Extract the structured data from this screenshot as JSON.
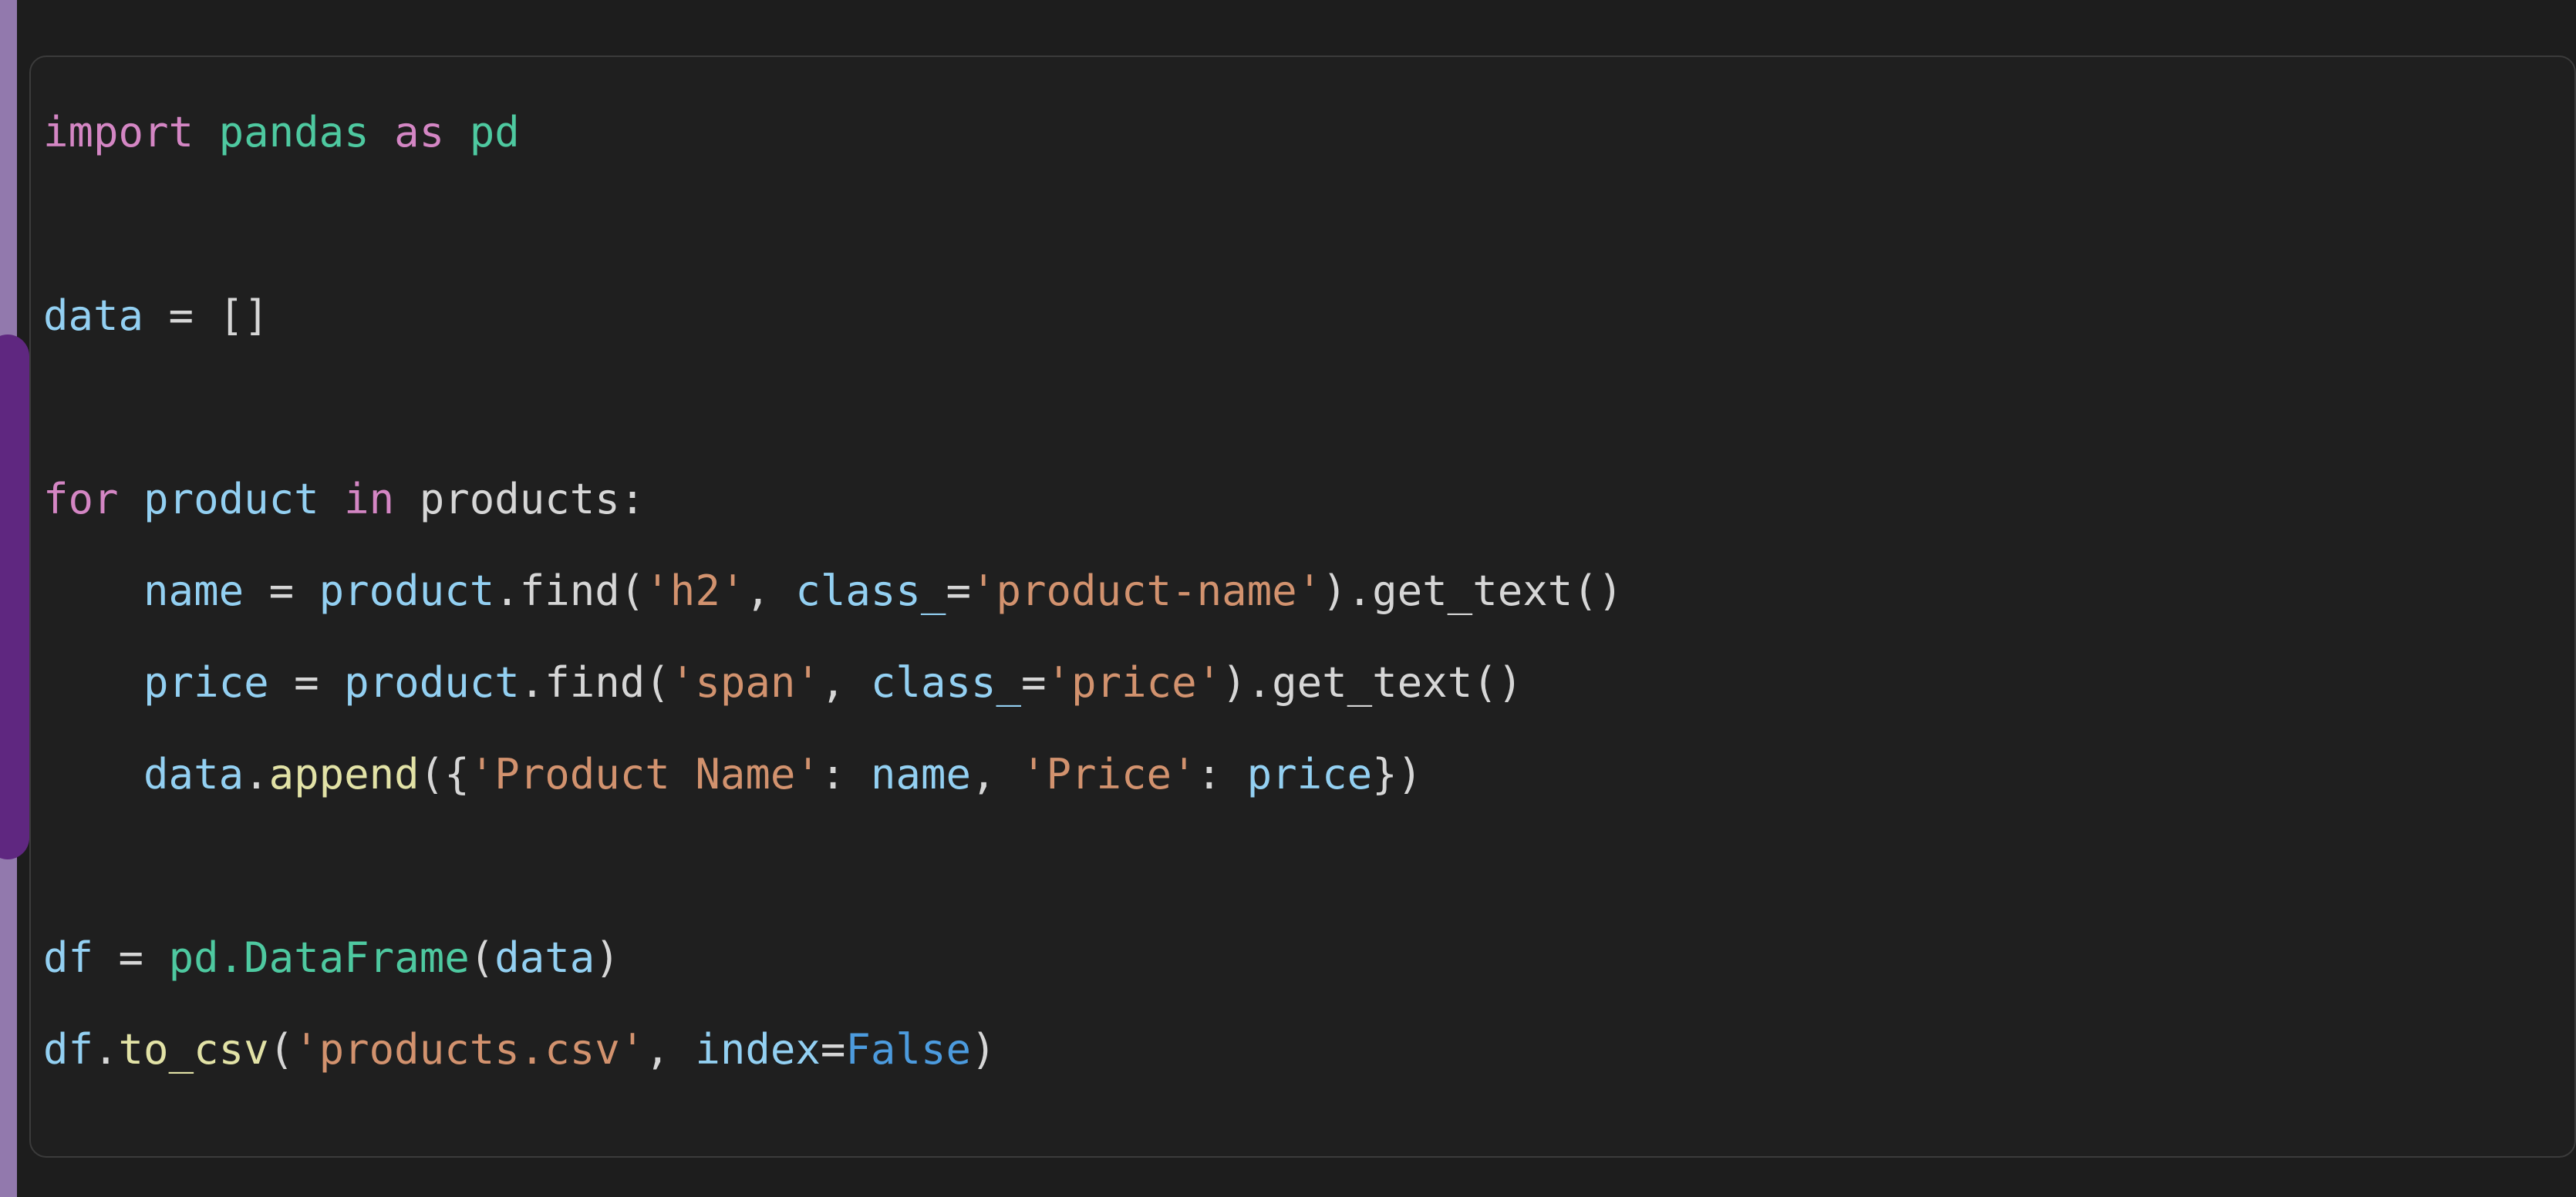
{
  "theme": {
    "page_background": "#1d1d1d",
    "code_background": "#1f1f1f",
    "code_border": "#3b3b3b",
    "rail_purple": "#9279ad",
    "accent_purple": "#5f2780",
    "keyword": "#d486c4",
    "module": "#4ec9a0",
    "variable": "#93d0f2",
    "string": "#d2926e",
    "function": "#e2e2a6",
    "punctuation": "#d6d6d6",
    "constant": "#4c9bde"
  },
  "code_block": {
    "language": "python",
    "full_text": "import pandas as pd\n\ndata = []\n\nfor product in products:\n    name = product.find('h2', class_='product-name').get_text()\n    price = product.find('span', class_='price').get_text()\n    data.append({'Product Name': name, 'Price': price})\n\ndf = pd.DataFrame(data)\ndf.to_csv('products.csv', index=False)",
    "lines": [
      {
        "n": 1,
        "text": "import pandas as pd"
      },
      {
        "n": 2,
        "text": ""
      },
      {
        "n": 3,
        "text": "data = []"
      },
      {
        "n": 4,
        "text": ""
      },
      {
        "n": 5,
        "text": "for product in products:"
      },
      {
        "n": 6,
        "text": "    name = product.find('h2', class_='product-name').get_text()"
      },
      {
        "n": 7,
        "text": "    price = product.find('span', class_='price').get_text()"
      },
      {
        "n": 8,
        "text": "    data.append({'Product Name': name, 'Price': price})"
      },
      {
        "n": 9,
        "text": ""
      },
      {
        "n": 10,
        "text": "df = pd.DataFrame(data)"
      },
      {
        "n": 11,
        "text": "df.to_csv('products.csv', index=False)"
      }
    ],
    "tokens": {
      "l1": {
        "kw_import": "import",
        "mod_pandas": " pandas",
        "kw_as": " as",
        "mod_pd": " pd"
      },
      "l3": {
        "var_data": "data",
        "op_eq": " = ",
        "brackets": "[]"
      },
      "l5": {
        "kw_for": "for",
        "var_product": " product",
        "kw_in": " in",
        "var_products": " products:"
      },
      "l6": {
        "indent": "    ",
        "var_name": "name",
        "op_eq": " = ",
        "var_product": "product",
        "dot_find": ".find(",
        "str_h2": "'h2'",
        "comma": ", ",
        "var_class": "class_",
        "op_eq2": "=",
        "str_product_name": "'product-name'",
        "tail": ").get_text()"
      },
      "l7": {
        "indent": "    ",
        "var_price": "price",
        "op_eq": " = ",
        "var_product": "product",
        "dot_find": ".find(",
        "str_span": "'span'",
        "comma": ", ",
        "var_class": "class_",
        "op_eq2": "=",
        "str_price": "'price'",
        "tail": ").get_text()"
      },
      "l8": {
        "indent": "    ",
        "var_data": "data",
        "dot": ".",
        "fn_append": "append",
        "open": "({",
        "str_product_name_key": "'Product Name'",
        "colon": ": ",
        "var_name": "name",
        "comma": ", ",
        "str_price_key": "'Price'",
        "colon2": ": ",
        "var_price": "price",
        "close": "})"
      },
      "l10": {
        "var_df": "df",
        "op_eq": " = ",
        "mod_pd": "pd",
        "dot": ".",
        "mod_dataframe": "DataFrame",
        "open": "(",
        "var_data": "data",
        "close": ")"
      },
      "l11": {
        "var_df": "df",
        "dot": ".",
        "fn_to_csv": "to_csv",
        "open": "(",
        "str_file": "'products.csv'",
        "comma": ", ",
        "var_index": "index",
        "op_eq": "=",
        "const_false": "False",
        "close": ")"
      }
    }
  }
}
